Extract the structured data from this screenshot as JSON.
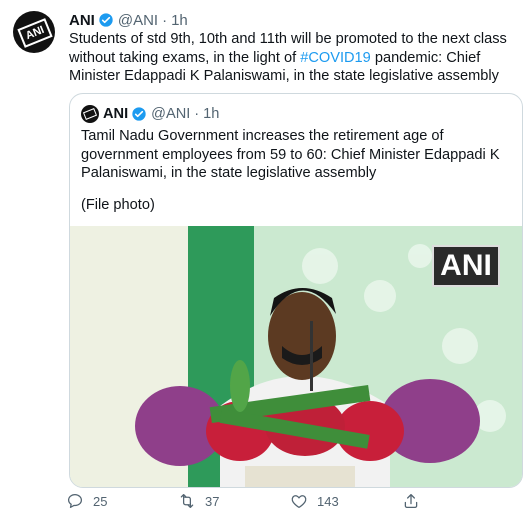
{
  "tweet": {
    "author_name": "ANI",
    "handle": "@ANI",
    "dot": "·",
    "time": "1h",
    "text_before_hashtag": "Students of std 9th, 10th and 11th will be promoted to the next class without taking exams, in the light of ",
    "hashtag": "#COVID19",
    "text_after_hashtag": " pandemic: Chief Minister Edappadi K Palaniswami, in the state legislative assembly"
  },
  "quoted": {
    "author_name": "ANI",
    "handle": "@ANI",
    "dot": "·",
    "time": "1h",
    "text": "Tamil Nadu Government increases the retirement age of government employees from 59 to 60: Chief Minister Edappadi K Palaniswami, in the state legislative assembly",
    "file_note": "(File photo)",
    "watermark": "ANI",
    "avatar_logo": "ANI"
  },
  "actions": {
    "reply_count": "25",
    "retweet_count": "37",
    "like_count": "143"
  },
  "colors": {
    "accent": "#1d9bf0",
    "secondary_text": "#536471",
    "border": "#cfd9de"
  },
  "icons": [
    "verified-icon",
    "reply-icon",
    "retweet-icon",
    "like-icon",
    "share-icon"
  ]
}
